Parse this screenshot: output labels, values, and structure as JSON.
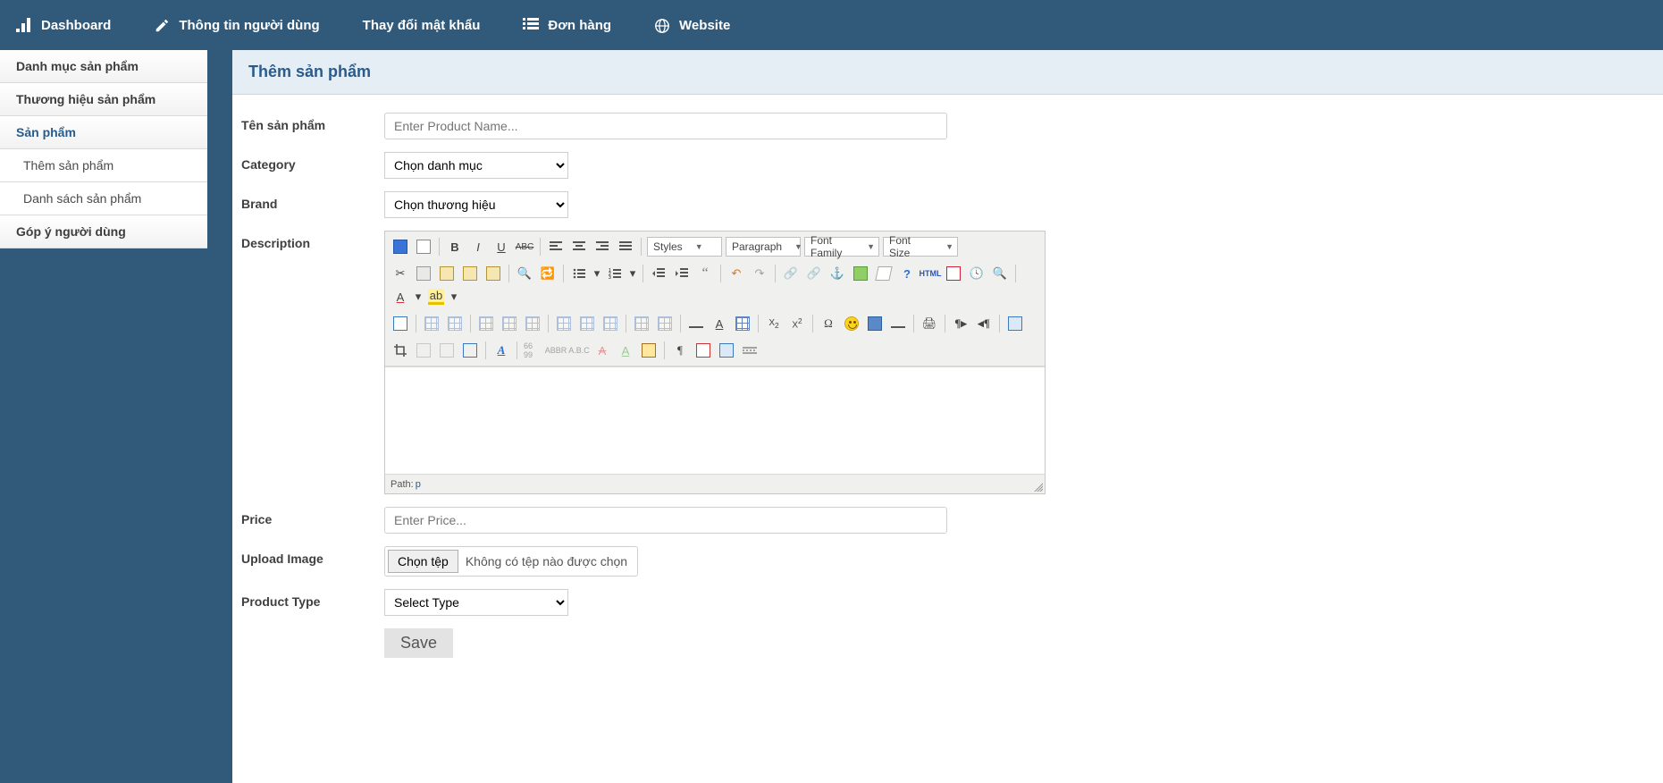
{
  "topnav": {
    "items": [
      {
        "label": "Dashboard",
        "icon": "bars-icon"
      },
      {
        "label": "Thông tin người dùng",
        "icon": "edit-icon"
      },
      {
        "label": "Thay đổi mật khẩu",
        "icon": ""
      },
      {
        "label": "Đơn hàng",
        "icon": "list-icon"
      },
      {
        "label": "Website",
        "icon": "globe-icon"
      }
    ]
  },
  "sidebar": {
    "items": [
      {
        "label": "Danh mục sản phẩm",
        "type": "group"
      },
      {
        "label": "Thương hiệu sản phẩm",
        "type": "group"
      },
      {
        "label": "Sản phẩm",
        "type": "group",
        "active": true
      },
      {
        "label": "Thêm sản phẩm",
        "type": "sub"
      },
      {
        "label": "Danh sách sản phẩm",
        "type": "sub"
      },
      {
        "label": "Góp ý người dùng",
        "type": "group"
      }
    ]
  },
  "page": {
    "title": "Thêm sản phẩm"
  },
  "form": {
    "product_name": {
      "label": "Tên sản phẩm",
      "placeholder": "Enter Product Name..."
    },
    "category": {
      "label": "Category",
      "selected": "Chọn danh mục"
    },
    "brand": {
      "label": "Brand",
      "selected": "Chọn thương hiệu"
    },
    "description": {
      "label": "Description"
    },
    "price": {
      "label": "Price",
      "placeholder": "Enter Price..."
    },
    "upload": {
      "label": "Upload Image",
      "button": "Chọn tệp",
      "status": "Không có tệp nào được chọn"
    },
    "product_type": {
      "label": "Product Type",
      "selected": "Select Type"
    },
    "save": "Save"
  },
  "rte": {
    "selects": {
      "styles": "Styles",
      "paragraph": "Paragraph",
      "font_family": "Font Family",
      "font_size": "Font Size"
    },
    "html": "HTML",
    "status_path": "Path:",
    "status_p": "p"
  }
}
